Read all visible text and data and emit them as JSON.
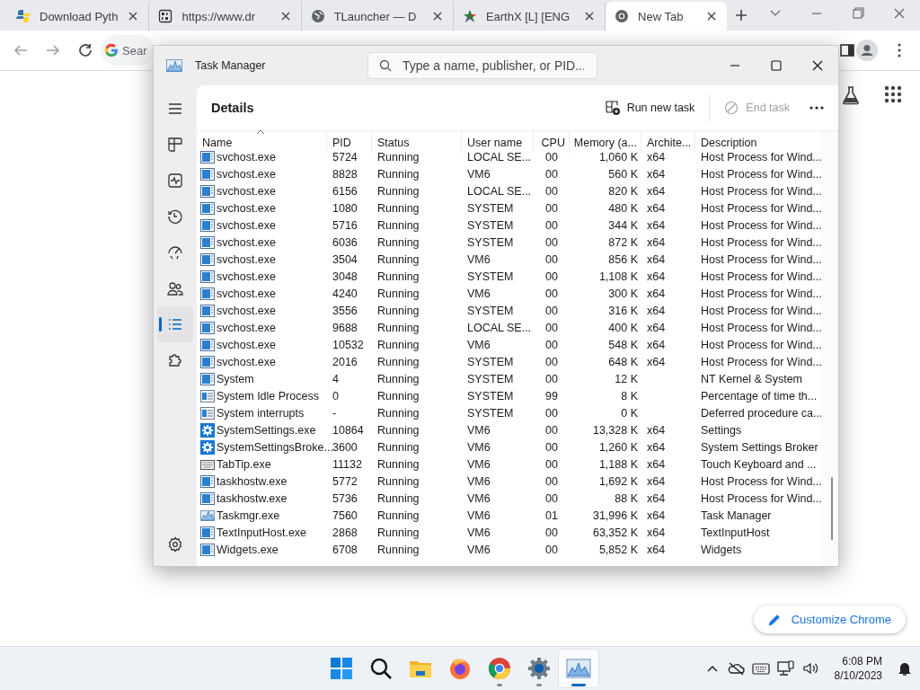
{
  "browser": {
    "tabs": [
      {
        "kind": "python",
        "title": "Download Pyth",
        "selected": false
      },
      {
        "kind": "binary",
        "title": "https://www.dr",
        "selected": false
      },
      {
        "kind": "globe",
        "title": "TLauncher — D",
        "selected": false
      },
      {
        "kind": "star",
        "title": "EarthX [L] [ENG",
        "selected": false
      },
      {
        "kind": "chrome",
        "title": "New Tab",
        "selected": true
      }
    ],
    "omnibox": {
      "value": "Sear"
    },
    "customize_button": "Customize Chrome"
  },
  "task_manager": {
    "window": {
      "title": "Task Manager"
    },
    "search": {
      "placeholder": "Type a name, publisher, or PID..."
    },
    "sidebar": {
      "items": [
        {
          "kind": "menu",
          "selected": false
        },
        {
          "kind": "processes",
          "selected": false
        },
        {
          "kind": "performance",
          "selected": false
        },
        {
          "kind": "history",
          "selected": false
        },
        {
          "kind": "startup",
          "selected": false
        },
        {
          "kind": "users",
          "selected": false
        },
        {
          "kind": "details",
          "selected": true
        },
        {
          "kind": "services",
          "selected": false
        },
        {
          "kind": "settings",
          "selected": false
        }
      ]
    },
    "page_title": "Details",
    "actions": [
      {
        "kind": "run",
        "label": "Run new task",
        "disabled": false
      },
      {
        "kind": "end",
        "label": "End task",
        "disabled": true
      }
    ],
    "table": {
      "columns": [
        "Name",
        "PID",
        "Status",
        "User name",
        "CPU",
        "Memory (a...",
        "Archite...",
        "Description"
      ],
      "rows": [
        {
          "kind": "service",
          "cells": [
            "svchost.exe",
            "5724",
            "Running",
            "LOCAL SE...",
            "00",
            "1,060 K",
            "x64",
            "Host Process for Wind..."
          ]
        },
        {
          "kind": "service",
          "cells": [
            "svchost.exe",
            "8828",
            "Running",
            "VM6",
            "00",
            "560 K",
            "x64",
            "Host Process for Wind..."
          ]
        },
        {
          "kind": "service",
          "cells": [
            "svchost.exe",
            "6156",
            "Running",
            "LOCAL SE...",
            "00",
            "820 K",
            "x64",
            "Host Process for Wind..."
          ]
        },
        {
          "kind": "service",
          "cells": [
            "svchost.exe",
            "1080",
            "Running",
            "SYSTEM",
            "00",
            "480 K",
            "x64",
            "Host Process for Wind..."
          ]
        },
        {
          "kind": "service",
          "cells": [
            "svchost.exe",
            "5716",
            "Running",
            "SYSTEM",
            "00",
            "344 K",
            "x64",
            "Host Process for Wind..."
          ]
        },
        {
          "kind": "service",
          "cells": [
            "svchost.exe",
            "6036",
            "Running",
            "SYSTEM",
            "00",
            "872 K",
            "x64",
            "Host Process for Wind..."
          ]
        },
        {
          "kind": "service",
          "cells": [
            "svchost.exe",
            "3504",
            "Running",
            "VM6",
            "00",
            "856 K",
            "x64",
            "Host Process for Wind..."
          ]
        },
        {
          "kind": "service",
          "cells": [
            "svchost.exe",
            "3048",
            "Running",
            "SYSTEM",
            "00",
            "1,108 K",
            "x64",
            "Host Process for Wind..."
          ]
        },
        {
          "kind": "service",
          "cells": [
            "svchost.exe",
            "4240",
            "Running",
            "VM6",
            "00",
            "300 K",
            "x64",
            "Host Process for Wind..."
          ]
        },
        {
          "kind": "service",
          "cells": [
            "svchost.exe",
            "3556",
            "Running",
            "SYSTEM",
            "00",
            "316 K",
            "x64",
            "Host Process for Wind..."
          ]
        },
        {
          "kind": "service",
          "cells": [
            "svchost.exe",
            "9688",
            "Running",
            "LOCAL SE...",
            "00",
            "400 K",
            "x64",
            "Host Process for Wind..."
          ]
        },
        {
          "kind": "service",
          "cells": [
            "svchost.exe",
            "10532",
            "Running",
            "VM6",
            "00",
            "548 K",
            "x64",
            "Host Process for Wind..."
          ]
        },
        {
          "kind": "service",
          "cells": [
            "svchost.exe",
            "2016",
            "Running",
            "SYSTEM",
            "00",
            "648 K",
            "x64",
            "Host Process for Wind..."
          ]
        },
        {
          "kind": "service",
          "cells": [
            "System",
            "4",
            "Running",
            "SYSTEM",
            "00",
            "12 K",
            "",
            "NT Kernel & System"
          ]
        },
        {
          "kind": "system",
          "cells": [
            "System Idle Process",
            "0",
            "Running",
            "SYSTEM",
            "99",
            "8 K",
            "",
            "Percentage of time th..."
          ]
        },
        {
          "kind": "system",
          "cells": [
            "System interrupts",
            "-",
            "Running",
            "SYSTEM",
            "00",
            "0 K",
            "",
            "Deferred procedure ca..."
          ]
        },
        {
          "kind": "gear",
          "cells": [
            "SystemSettings.exe",
            "10864",
            "Running",
            "VM6",
            "00",
            "13,328 K",
            "x64",
            "Settings"
          ]
        },
        {
          "kind": "gear",
          "cells": [
            "SystemSettingsBroke...",
            "3600",
            "Running",
            "VM6",
            "00",
            "1,260 K",
            "x64",
            "System Settings Broker"
          ]
        },
        {
          "kind": "keyboard",
          "cells": [
            "TabTip.exe",
            "11132",
            "Running",
            "VM6",
            "00",
            "1,188 K",
            "x64",
            "Touch Keyboard and ..."
          ]
        },
        {
          "kind": "service",
          "cells": [
            "taskhostw.exe",
            "5772",
            "Running",
            "VM6",
            "00",
            "1,692 K",
            "x64",
            "Host Process for Wind..."
          ]
        },
        {
          "kind": "service",
          "cells": [
            "taskhostw.exe",
            "5736",
            "Running",
            "VM6",
            "00",
            "88 K",
            "x64",
            "Host Process for Wind..."
          ]
        },
        {
          "kind": "chart",
          "cells": [
            "Taskmgr.exe",
            "7560",
            "Running",
            "VM6",
            "01",
            "31,996 K",
            "x64",
            "Task Manager"
          ]
        },
        {
          "kind": "service",
          "cells": [
            "TextInputHost.exe",
            "2868",
            "Running",
            "VM6",
            "00",
            "63,352 K",
            "x64",
            "TextInputHost"
          ]
        },
        {
          "kind": "service",
          "cells": [
            "Widgets.exe",
            "6708",
            "Running",
            "VM6",
            "00",
            "5,852 K",
            "x64",
            "Widgets"
          ]
        }
      ]
    }
  },
  "taskbar": {
    "apps": [
      {
        "kind": "start",
        "running": false,
        "selected": false
      },
      {
        "kind": "search",
        "running": false,
        "selected": false
      },
      {
        "kind": "folder",
        "running": false,
        "selected": false
      },
      {
        "kind": "firefox",
        "running": false,
        "selected": false
      },
      {
        "kind": "chrome",
        "running": true,
        "selected": false
      },
      {
        "kind": "settings",
        "running": true,
        "selected": false
      },
      {
        "kind": "taskmgr",
        "running": true,
        "selected": true
      }
    ],
    "time": "6:08 PM",
    "date": "8/10/2023"
  }
}
